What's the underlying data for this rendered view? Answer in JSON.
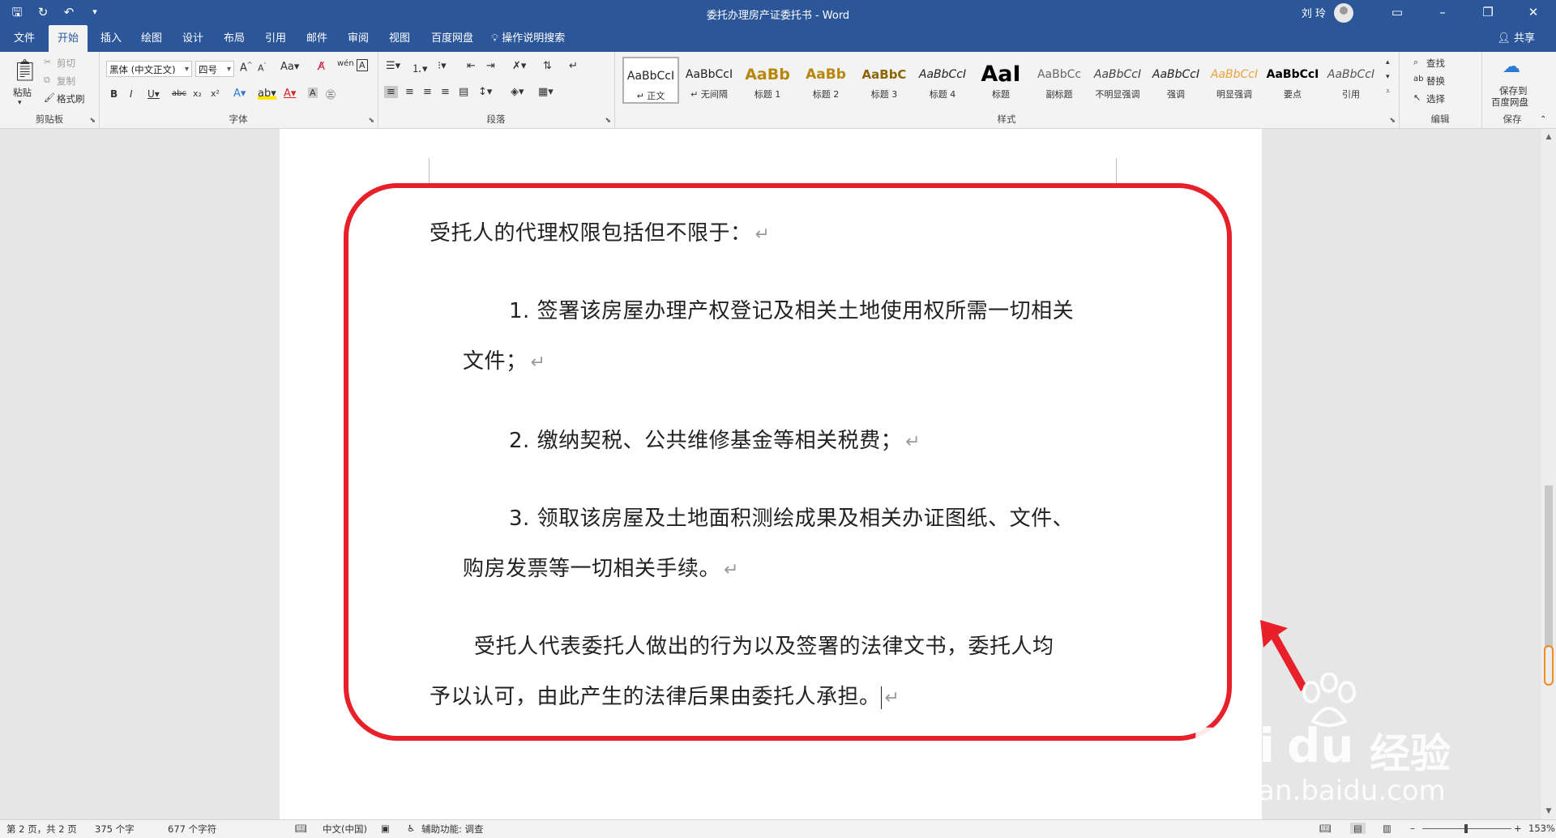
{
  "title_bar": {
    "doc_title": "委托办理房产证委托书  -  Word",
    "user_name": "刘 玲"
  },
  "tabs": [
    {
      "label": "文件"
    },
    {
      "label": "开始",
      "active": true
    },
    {
      "label": "插入"
    },
    {
      "label": "绘图"
    },
    {
      "label": "设计"
    },
    {
      "label": "布局"
    },
    {
      "label": "引用"
    },
    {
      "label": "邮件"
    },
    {
      "label": "审阅"
    },
    {
      "label": "视图"
    },
    {
      "label": "百度网盘"
    }
  ],
  "tell_me": "操作说明搜索",
  "share": "共享",
  "clipboard": {
    "paste": "粘贴",
    "cut": "剪切",
    "copy": "复制",
    "format_painter": "格式刷",
    "label": "剪贴板"
  },
  "font": {
    "name": "黑体 (中文正文)",
    "size": "四号",
    "label": "字体"
  },
  "paragraph": {
    "label": "段落"
  },
  "styles": {
    "label": "样式",
    "items": [
      {
        "preview": "AaBbCcI",
        "name": "↵ 正文",
        "color": "#222222"
      },
      {
        "preview": "AaBbCcI",
        "name": "↵ 无间隔",
        "color": "#222222"
      },
      {
        "preview": "AaBb",
        "name": "标题 1",
        "color": "#b8860b"
      },
      {
        "preview": "AaBb",
        "name": "标题 2",
        "color": "#b8860b"
      },
      {
        "preview": "AaBbC",
        "name": "标题 3",
        "color": "#8b6500"
      },
      {
        "preview": "AaBbCcI",
        "name": "标题 4",
        "color": "#222222"
      },
      {
        "preview": "AaI",
        "name": "标题",
        "color": "#000000"
      },
      {
        "preview": "AaBbCc",
        "name": "副标题",
        "color": "#666666"
      },
      {
        "preview": "AaBbCcI",
        "name": "不明显强调",
        "color": "#444444"
      },
      {
        "preview": "AaBbCcI",
        "name": "强调",
        "color": "#222222"
      },
      {
        "preview": "AaBbCcI",
        "name": "明显强调",
        "color": "#e8a33b"
      },
      {
        "preview": "AaBbCcI",
        "name": "要点",
        "color": "#000000"
      },
      {
        "preview": "AaBbCcI",
        "name": "引用",
        "color": "#555555"
      }
    ]
  },
  "editing": {
    "find": "查找",
    "replace": "替换",
    "select": "选择",
    "label": "编辑"
  },
  "save": {
    "line1": "保存到",
    "line2": "百度网盘",
    "label": "保存"
  },
  "document": {
    "heading": "受托人的代理权限包括但不限于：",
    "item1_line1": "1. 签署该房屋办理产权登记及相关土地使用权所需一切相关",
    "item1_line2": "文件；",
    "item2": "2. 缴纳契税、公共维修基金等相关税费；",
    "item3_line1": "3. 领取该房屋及土地面积测绘成果及相关办证图纸、文件、",
    "item3_line2": "购房发票等一切相关手续。",
    "closing_line1": "受托人代表委托人做出的行为以及签署的法律文书，委托人均",
    "closing_line2": "予以认可，由此产生的法律后果由委托人承担。",
    "paragraph_mark": "↵"
  },
  "status_bar": {
    "page": "第 2 页，共 2 页",
    "words": "375 个字",
    "chars": "677 个字符",
    "language": "中文(中国)",
    "accessibility": "辅助功能: 调查",
    "zoom": "153%"
  },
  "watermark": {
    "brand": "Bai",
    "brand2": "du",
    "cn": "经验",
    "url": "jingyan.baidu.com"
  },
  "colors": {
    "title_bar": "#2b579a",
    "callout": "#e8202a",
    "ribbon": "#f3f3f3"
  }
}
